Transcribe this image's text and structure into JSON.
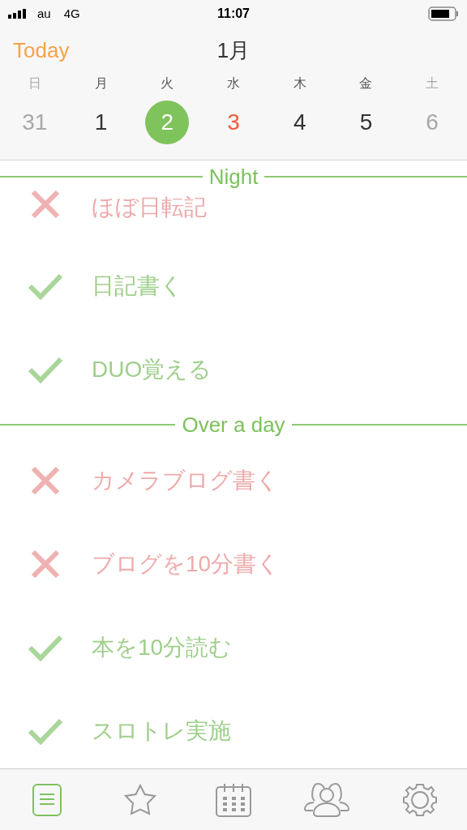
{
  "status_bar": {
    "carrier": "au",
    "network": "4G",
    "time": "11:07"
  },
  "header": {
    "today_button": "Today",
    "month": "1月"
  },
  "week": [
    {
      "weekday": "日",
      "date": "31",
      "kind": "weekend",
      "selected": false
    },
    {
      "weekday": "月",
      "date": "1",
      "kind": "weekday",
      "selected": false
    },
    {
      "weekday": "火",
      "date": "2",
      "kind": "weekday",
      "selected": true
    },
    {
      "weekday": "水",
      "date": "3",
      "kind": "highlight",
      "selected": false
    },
    {
      "weekday": "木",
      "date": "4",
      "kind": "weekday",
      "selected": false
    },
    {
      "weekday": "金",
      "date": "5",
      "kind": "weekday",
      "selected": false
    },
    {
      "weekday": "土",
      "date": "6",
      "kind": "weekend",
      "selected": false
    }
  ],
  "sections": [
    {
      "title": "Night",
      "tasks": [
        {
          "label": "ほぼ日転記",
          "done": false
        },
        {
          "label": "日記書く",
          "done": true
        },
        {
          "label": "DUO覚える",
          "done": true
        }
      ]
    },
    {
      "title": "Over a day",
      "tasks": [
        {
          "label": "カメラブログ書く",
          "done": false
        },
        {
          "label": "ブログを10分書く",
          "done": false
        },
        {
          "label": "本を10分読む",
          "done": true
        },
        {
          "label": "スロトレ実施",
          "done": true
        }
      ]
    }
  ],
  "tab_bar": [
    {
      "kind": "list",
      "selected": true
    },
    {
      "kind": "star",
      "selected": false
    },
    {
      "kind": "calendar",
      "selected": false
    },
    {
      "kind": "people",
      "selected": false
    },
    {
      "kind": "settings",
      "selected": false
    }
  ]
}
